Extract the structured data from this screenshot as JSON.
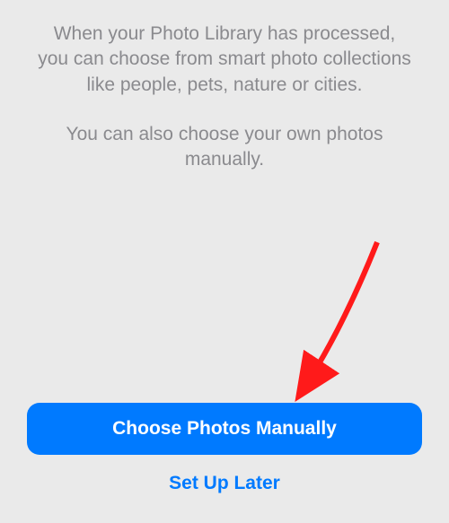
{
  "content": {
    "paragraph1": "When your Photo Library has processed, you can choose from smart photo collections like people, pets, nature or cities.",
    "paragraph2": "You can also choose your own photos manually."
  },
  "actions": {
    "primary_label": "Choose Photos Manually",
    "secondary_label": "Set Up Later"
  },
  "colors": {
    "accent": "#007aff",
    "background": "#eaeaea",
    "muted_text": "#8a8a8e",
    "annotation": "#ff1a1a"
  }
}
